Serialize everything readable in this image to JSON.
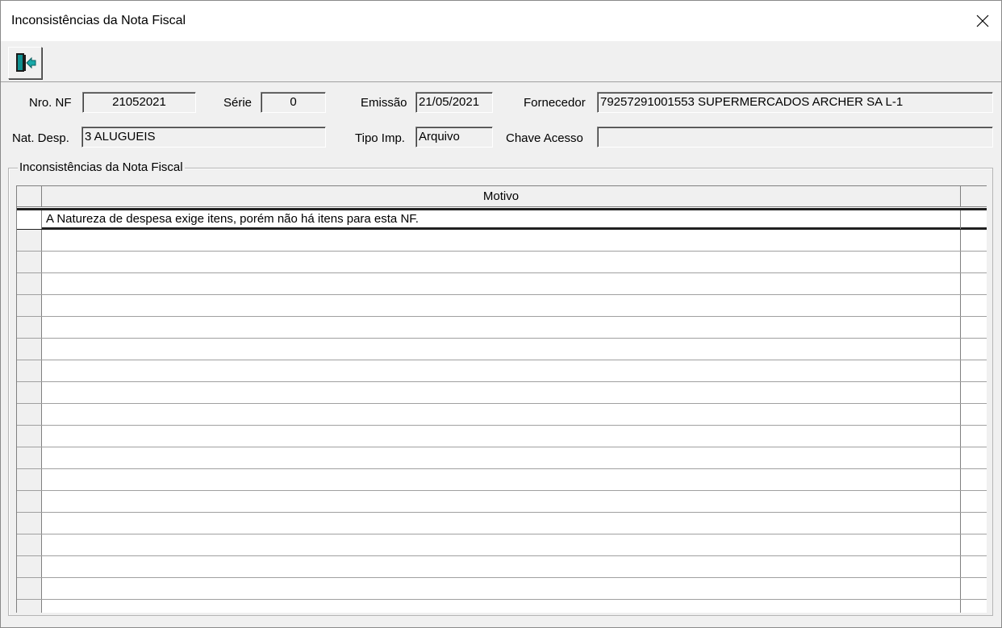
{
  "window": {
    "title": "Inconsistências da Nota Fiscal"
  },
  "toolbar": {
    "exit_icon": "exit-door-icon"
  },
  "header_fields": {
    "nro_nf": {
      "label": "Nro. NF",
      "value": "21052021"
    },
    "serie": {
      "label": "Série",
      "value": "0"
    },
    "emissao": {
      "label": "Emissão",
      "value": "21/05/2021"
    },
    "fornecedor": {
      "label": "Fornecedor",
      "value": "79257291001553  SUPERMERCADOS ARCHER SA L-1"
    },
    "nat_desp": {
      "label": "Nat. Desp.",
      "value": "3  ALUGUEIS"
    },
    "tipo_imp": {
      "label": "Tipo Imp.",
      "value": "Arquivo"
    },
    "chave_acesso": {
      "label": "Chave Acesso",
      "value": ""
    }
  },
  "group": {
    "title": "Inconsistências da Nota Fiscal"
  },
  "grid": {
    "columns": [
      "Motivo"
    ],
    "rows": [
      "A Natureza de despesa exige itens, porém não há itens para esta NF."
    ],
    "empty_rows": 18
  },
  "colors": {
    "window_bg": "#f0f0f0",
    "grid_bg": "#ffffff",
    "selection_border": "#202020"
  }
}
